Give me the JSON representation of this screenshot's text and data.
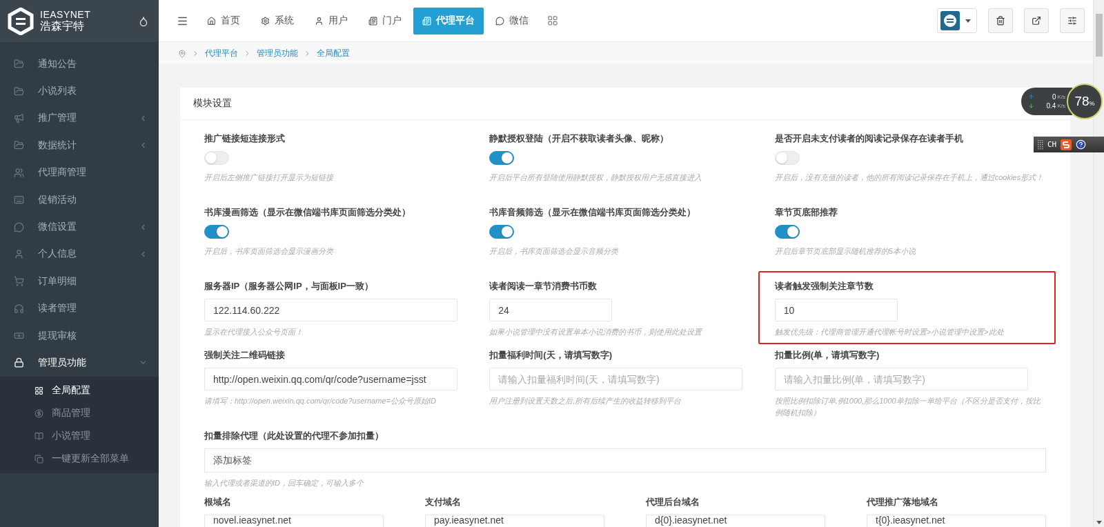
{
  "brand": {
    "name": "IEASYNET",
    "subtitle": "浩森宇特"
  },
  "sidebar": {
    "items": [
      {
        "label": "通知公告",
        "kind": "link",
        "selected": false
      },
      {
        "label": "小说列表",
        "kind": "link",
        "selected": false
      },
      {
        "label": "推广管理",
        "kind": "group",
        "expanded": false,
        "selected": false
      },
      {
        "label": "数据统计",
        "kind": "group",
        "expanded": false,
        "selected": false
      },
      {
        "label": "代理商管理",
        "kind": "link",
        "selected": false
      },
      {
        "label": "促销活动",
        "kind": "link",
        "selected": false
      },
      {
        "label": "微信设置",
        "kind": "group",
        "expanded": false,
        "selected": false
      },
      {
        "label": "个人信息",
        "kind": "group",
        "expanded": false,
        "selected": false
      },
      {
        "label": "订单明细",
        "kind": "link",
        "selected": false
      },
      {
        "label": "读者管理",
        "kind": "link",
        "selected": false
      },
      {
        "label": "提现审核",
        "kind": "link",
        "selected": false
      },
      {
        "label": "管理员功能",
        "kind": "group",
        "expanded": true,
        "selected": true,
        "children": [
          {
            "label": "全局配置",
            "selected": true
          },
          {
            "label": "商品管理",
            "selected": false
          },
          {
            "label": "小说管理",
            "selected": false
          },
          {
            "label": "一键更新全部菜单",
            "selected": false
          }
        ]
      }
    ]
  },
  "top_nav": {
    "tabs": [
      {
        "label": "首页",
        "selected": false
      },
      {
        "label": "系统",
        "selected": false
      },
      {
        "label": "用户",
        "selected": false
      },
      {
        "label": "门户",
        "selected": false
      },
      {
        "label": "代理平台",
        "selected": true
      },
      {
        "label": "微信",
        "selected": false
      }
    ]
  },
  "breadcrumb": [
    "代理平台",
    "管理员功能",
    "全局配置"
  ],
  "panel": {
    "title": "模块设置",
    "fields": [
      {
        "kind": "toggle",
        "label": "推广链接短连接形式",
        "on": false,
        "help": "开启后左侧推广链接打开显示为短链接",
        "highlighted": false
      },
      {
        "kind": "toggle",
        "label": "静默授权登陆（开启不获取读者头像、昵称）",
        "on": true,
        "help": "开启后平台所有登陆使用静默授权，静默授权用户无感直接进入",
        "highlighted": false
      },
      {
        "kind": "toggle",
        "label": "是否开启未支付读者的阅读记录保存在读者手机",
        "on": false,
        "help": "开启后，没有充值的读者，他的所有阅读记录保存在手机上，通过cookies形式！",
        "highlighted": false
      },
      {
        "kind": "toggle",
        "label": "书库漫画筛选（显示在微信端书库页面筛选分类处）",
        "on": true,
        "help": "开启后，书库页面筛选会显示漫画分类",
        "highlighted": false
      },
      {
        "kind": "toggle",
        "label": "书库音频筛选（显示在微信端书库页面筛选分类处）",
        "on": true,
        "help": "开启后，书库页面筛选会显示音频分类",
        "highlighted": false
      },
      {
        "kind": "toggle",
        "label": "章节页底部推荐",
        "on": true,
        "help": "开启后章节页底部显示随机推荐的5本小说",
        "highlighted": false
      },
      {
        "kind": "text",
        "label": "服务器IP（服务器公网IP，与面板IP一致）",
        "value": "122.114.60.222",
        "help": "显示在代理接入公众号页面！",
        "highlighted": false
      },
      {
        "kind": "number",
        "label": "读者阅读一章节消费书币数",
        "value": "24",
        "help": "如果小说管理中没有设置单本小说消费的书币，则使用此处设置",
        "highlighted": false
      },
      {
        "kind": "number",
        "label": "读者触发强制关注章节数",
        "value": "10",
        "help": "触发优先级：代理商管理开通代理帐号时设置>小说管理中设置>此处",
        "highlighted": true
      },
      {
        "kind": "text",
        "label": "强制关注二维码链接",
        "value": "http://open.weixin.qq.com/qr/code?username=jsst",
        "help": "请填写：http://open.weixin.qq.com/qr/code?username=公众号原始ID",
        "highlighted": false
      },
      {
        "kind": "text",
        "label": "扣量福利时间(天，请填写数字)",
        "placeholder": "请输入扣量福利时间(天，请填写数字)",
        "help": "用户注册到设置天数之后,所有后续产生的收益转移到平台",
        "highlighted": false
      },
      {
        "kind": "text",
        "label": "扣量比例(单，请填写数字)",
        "placeholder": "请输入扣量比例(单，请填写数字)",
        "help": "按照比例扣除订单,例1000,那么1000单扣除一单给平台（不区分是否支付，按比例随机扣除）",
        "highlighted": false
      },
      {
        "kind": "tags",
        "label": "扣量排除代理（此处设置的代理不参加扣量）",
        "placeholder": "添加标签",
        "help": "输入代理或者渠道的ID，回车确定，可输入多个",
        "highlighted": false
      }
    ],
    "domains": [
      {
        "label": "根域名",
        "value": "novel.ieasynet.net"
      },
      {
        "label": "支付域名",
        "value": "pay.ieasynet.net"
      },
      {
        "label": "代理后台域名",
        "value": "d{0}.ieasynet.net"
      },
      {
        "label": "代理推广落地域名",
        "value": "t{0}.ieasynet.net"
      }
    ]
  },
  "net_monitor": {
    "upload": "0",
    "upload_unit": "K/s",
    "download": "0.4",
    "download_unit": "K/s",
    "load": "78",
    "load_unit": "%"
  },
  "ime_bar": {
    "label": "CH"
  }
}
